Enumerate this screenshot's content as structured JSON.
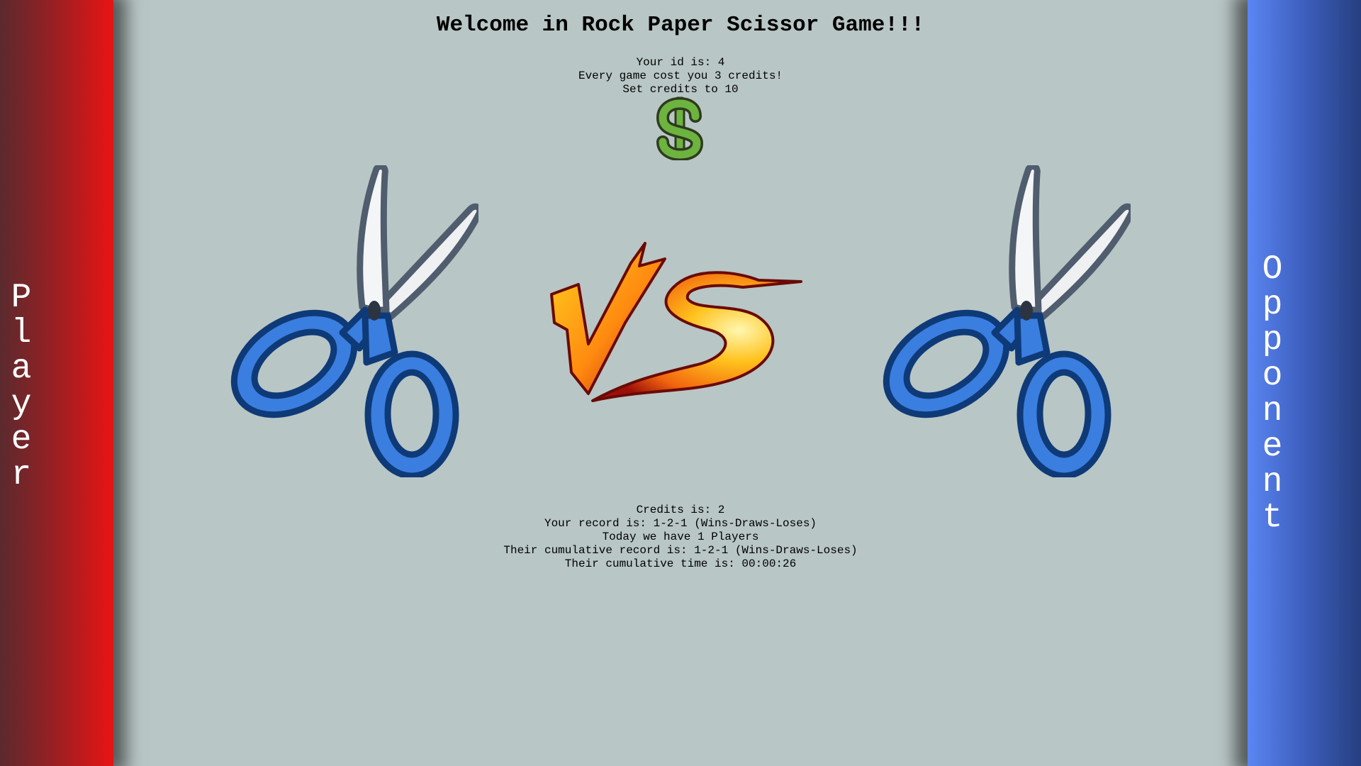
{
  "player_panel": {
    "label_chars": [
      "P",
      "l",
      "a",
      "y",
      "e",
      "r"
    ],
    "color": "#e81414"
  },
  "opponent_panel": {
    "label_chars": [
      "O",
      "p",
      "p",
      "o",
      "n",
      "e",
      "n",
      "t"
    ],
    "color": "#3f62c3"
  },
  "header": {
    "title": "Welcome in Rock Paper Scissor Game!!!"
  },
  "info_top": {
    "id_line": "Your id is: 4",
    "cost_line": "Every game cost you 3 credits!",
    "set_credits_line": "Set credits to 10"
  },
  "icons": {
    "credits": "dollar-icon",
    "player_choice": "scissors-icon",
    "opponent_choice": "scissors-icon",
    "versus": "vs-icon"
  },
  "stats": {
    "credits_line": "Credits is: 2",
    "record_line": "Your record is: 1-2-1 (Wins-Draws-Loses)",
    "players_line": "Today we have 1 Players",
    "cumulative_record_line": "Their cumulative record is: 1-2-1 (Wins-Draws-Loses)",
    "cumulative_time_line": "Their cumulative time is: 00:00:26"
  },
  "colors": {
    "background": "#b8c6c5",
    "scissors_handle": "#3a7ee0",
    "dollar": "#6db33f"
  }
}
